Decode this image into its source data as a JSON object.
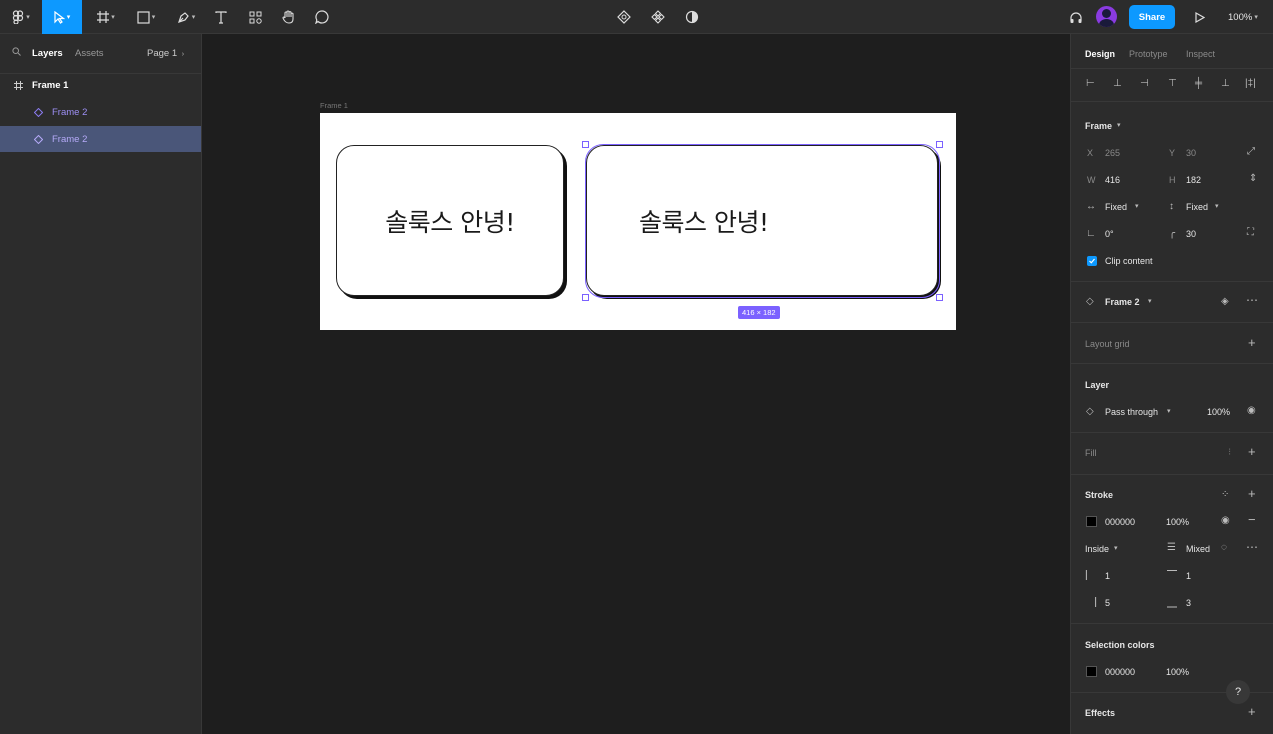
{
  "toolbar": {
    "share_label": "Share",
    "zoom_label": "100%"
  },
  "left_panel": {
    "tabs": [
      "Layers",
      "Assets"
    ],
    "page_label": "Page 1",
    "layers": [
      {
        "label": "Frame 1",
        "level": 0,
        "selected": false
      },
      {
        "label": "Frame 2",
        "level": 1,
        "selected": false
      },
      {
        "label": "Frame 2",
        "level": 1,
        "selected": true
      }
    ]
  },
  "canvas": {
    "frame_label": "Frame 1",
    "card1_text": "솔룩스 안녕!",
    "card2_text": "솔룩스 안녕!",
    "dimension_badge": "416 × 182"
  },
  "right_panel": {
    "tabs": [
      "Design",
      "Prototype",
      "Inspect"
    ],
    "frame_section": "Frame",
    "x_label": "X",
    "x_value": "265",
    "y_label": "Y",
    "y_value": "30",
    "w_label": "W",
    "w_value": "416",
    "h_label": "H",
    "h_value": "182",
    "h_sizing": "Fixed",
    "v_sizing": "Fixed",
    "rotation": "0°",
    "corner_radius": "30",
    "clip_content": "Clip content",
    "component_name": "Frame 2",
    "layout_grid": "Layout grid",
    "layer_section": "Layer",
    "blend_mode": "Pass through",
    "layer_opacity": "100%",
    "fill_section": "Fill",
    "stroke_section": "Stroke",
    "stroke_color": "000000",
    "stroke_opacity": "100%",
    "stroke_position": "Inside",
    "stroke_weight": "Mixed",
    "stroke_left": "1",
    "stroke_top": "1",
    "stroke_right": "5",
    "stroke_bottom": "3",
    "selection_colors": "Selection colors",
    "sel_color": "000000",
    "sel_opacity": "100%",
    "effects": "Effects",
    "help": "?"
  }
}
